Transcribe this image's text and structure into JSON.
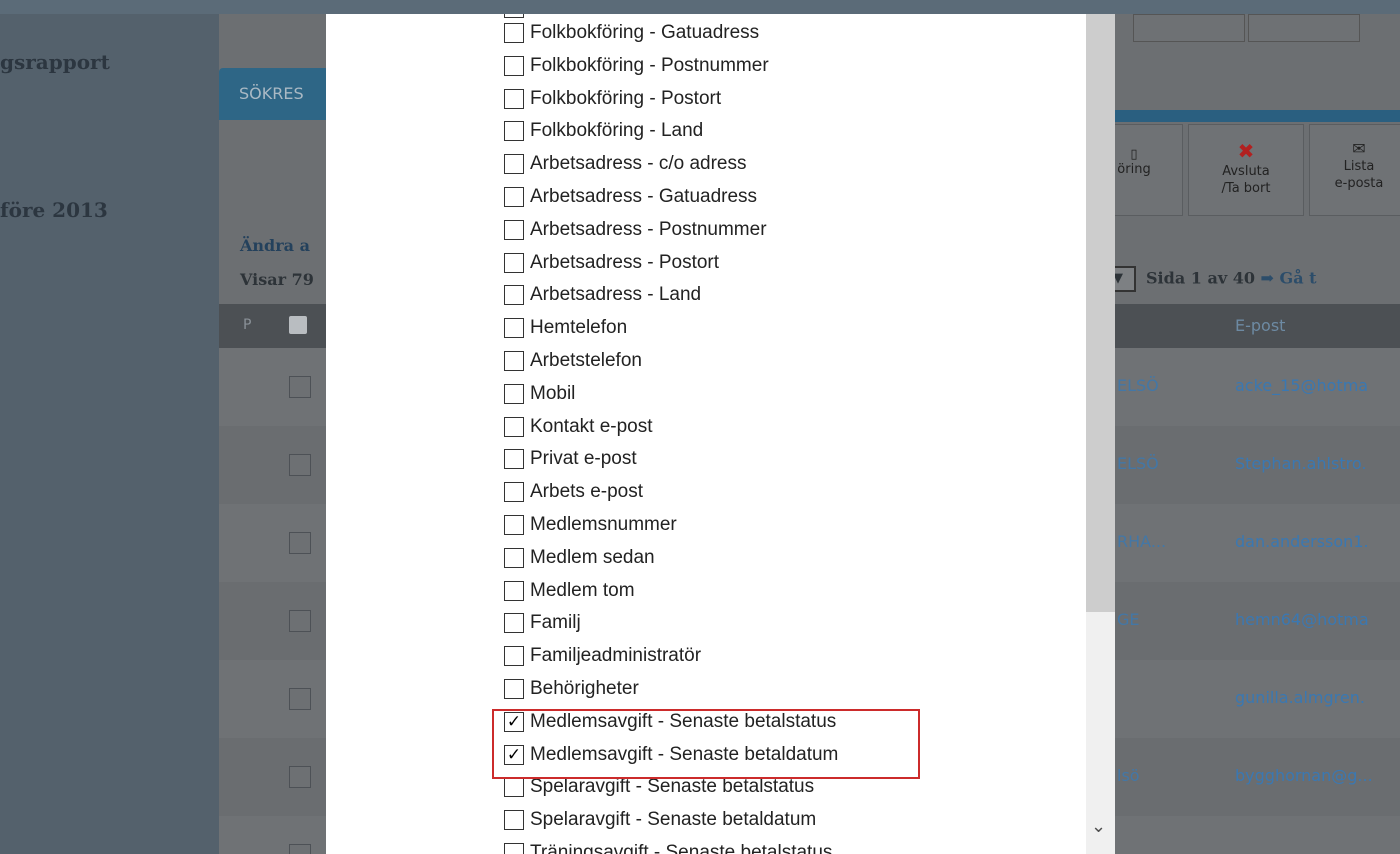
{
  "sidebar": {
    "links": [
      "gsrapport",
      "före 2013",
      "Ändra a"
    ]
  },
  "tab": {
    "label": "SÖKRES"
  },
  "list_header": {
    "visar": "Visar 79",
    "p_label": "P",
    "email_col": "E-post"
  },
  "toolbar": {
    "buttons": [
      {
        "label": "öring"
      },
      {
        "label": "Avsluta\n/Ta bort"
      },
      {
        "label": "Lista\ne-posta"
      }
    ]
  },
  "paging": {
    "text": "Sida 1 av 40",
    "go": "Gå t"
  },
  "rows": [
    {
      "club": "ELSÖ",
      "email": "acke_15@hotma"
    },
    {
      "club": "ELSÖ",
      "email": "Stephan.ahlstro."
    },
    {
      "club": "RHA...",
      "email": "dan.andersson1."
    },
    {
      "club": "GE",
      "email": "hemn64@hotma"
    },
    {
      "club": "",
      "email": "gunilla.almgren."
    },
    {
      "club": "lsö",
      "email": "bygghornan@g..."
    }
  ],
  "modal": {
    "options": [
      {
        "label": "Folkbokföring - Gatuadress",
        "checked": false
      },
      {
        "label": "Folkbokföring - Postnummer",
        "checked": false
      },
      {
        "label": "Folkbokföring - Postort",
        "checked": false
      },
      {
        "label": "Folkbokföring - Land",
        "checked": false
      },
      {
        "label": "Arbetsadress - c/o adress",
        "checked": false
      },
      {
        "label": "Arbetsadress - Gatuadress",
        "checked": false
      },
      {
        "label": "Arbetsadress - Postnummer",
        "checked": false
      },
      {
        "label": "Arbetsadress - Postort",
        "checked": false
      },
      {
        "label": "Arbetsadress - Land",
        "checked": false
      },
      {
        "label": "Hemtelefon",
        "checked": false
      },
      {
        "label": "Arbetstelefon",
        "checked": false
      },
      {
        "label": "Mobil",
        "checked": false
      },
      {
        "label": "Kontakt e-post",
        "checked": false
      },
      {
        "label": "Privat e-post",
        "checked": false
      },
      {
        "label": "Arbets e-post",
        "checked": false
      },
      {
        "label": "Medlemsnummer",
        "checked": false
      },
      {
        "label": "Medlem sedan",
        "checked": false
      },
      {
        "label": "Medlem tom",
        "checked": false
      },
      {
        "label": "Familj",
        "checked": false
      },
      {
        "label": "Familjeadministratör",
        "checked": false
      },
      {
        "label": "Behörigheter",
        "checked": false
      },
      {
        "label": "Medlemsavgift - Senaste betalstatus",
        "checked": true
      },
      {
        "label": "Medlemsavgift - Senaste betaldatum",
        "checked": true
      },
      {
        "label": "Spelaravgift - Senaste betalstatus",
        "checked": false
      },
      {
        "label": "Spelaravgift - Senaste betaldatum",
        "checked": false
      },
      {
        "label": "Träningsavgift - Senaste betalstatus",
        "checked": false
      }
    ]
  },
  "colors": {
    "highlight": "#cc2b2b",
    "tab": "#2e6686",
    "link": "#3a78b2"
  }
}
